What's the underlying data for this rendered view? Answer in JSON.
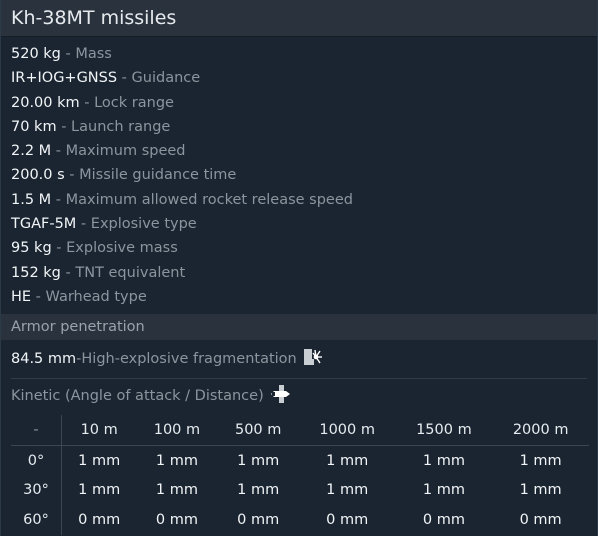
{
  "title": "Kh-38MT missiles",
  "stats": [
    {
      "value": "520 kg",
      "label": "Mass"
    },
    {
      "value": "IR+IOG+GNSS",
      "label": "Guidance"
    },
    {
      "value": "20.00 km",
      "label": "Lock range"
    },
    {
      "value": "70 km",
      "label": "Launch range"
    },
    {
      "value": "2.2 M",
      "label": "Maximum speed"
    },
    {
      "value": "200.0 s",
      "label": "Missile guidance time"
    },
    {
      "value": "1.5 M",
      "label": "Maximum allowed rocket release speed"
    },
    {
      "value": "TGAF-5M",
      "label": "Explosive type"
    },
    {
      "value": "95 kg",
      "label": "Explosive mass"
    },
    {
      "value": "152 kg",
      "label": "TNT equivalent"
    },
    {
      "value": "HE",
      "label": "Warhead type"
    }
  ],
  "separator": " - ",
  "armor": {
    "heading": "Armor penetration",
    "he": {
      "value": "84.5 mm",
      "label": "High-explosive fragmentation",
      "icon": "explosion-icon"
    },
    "kinetic_heading": "Kinetic (Angle of attack / Distance)",
    "kinetic_icon": "projectile-icon",
    "table": {
      "corner": "-",
      "distances": [
        "10 m",
        "100 m",
        "500 m",
        "1000 m",
        "1500 m",
        "2000 m"
      ],
      "rows": [
        {
          "angle": "0°",
          "values": [
            "1 mm",
            "1 mm",
            "1 mm",
            "1 mm",
            "1 mm",
            "1 mm"
          ]
        },
        {
          "angle": "30°",
          "values": [
            "1 mm",
            "1 mm",
            "1 mm",
            "1 mm",
            "1 mm",
            "1 mm"
          ]
        },
        {
          "angle": "60°",
          "values": [
            "0 mm",
            "0 mm",
            "0 mm",
            "0 mm",
            "0 mm",
            "0 mm"
          ]
        }
      ]
    }
  }
}
